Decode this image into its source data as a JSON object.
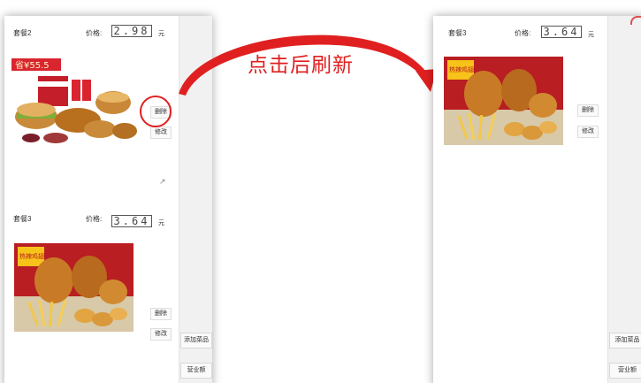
{
  "annotation": {
    "caption": "点击后刷新"
  },
  "left_panel": {
    "meals": [
      {
        "name": "套餐2",
        "price_label": "价格:",
        "price": "2.98",
        "unit": "元",
        "badge": "省¥55.5",
        "delete_label": "删除",
        "edit_label": "修改"
      },
      {
        "name": "套餐3",
        "price_label": "价格:",
        "price": "3.64",
        "unit": "元",
        "badge": "热辣鸡翅",
        "delete_label": "删除",
        "edit_label": "修改"
      }
    ],
    "side": {
      "add_label": "添加菜品",
      "revenue_label": "营业额"
    }
  },
  "right_panel": {
    "meals": [
      {
        "name": "套餐3",
        "price_label": "价格:",
        "price": "3.64",
        "unit": "元",
        "badge": "热辣鸡翅",
        "delete_label": "删除",
        "edit_label": "修改"
      }
    ],
    "side": {
      "add_label": "添加菜品",
      "revenue_label": "营业额"
    }
  },
  "colors": {
    "annotation_red": "#e02020",
    "badge_red": "#d9252f",
    "panel_bg": "#ffffff",
    "side_bg": "#f1f1f1"
  }
}
